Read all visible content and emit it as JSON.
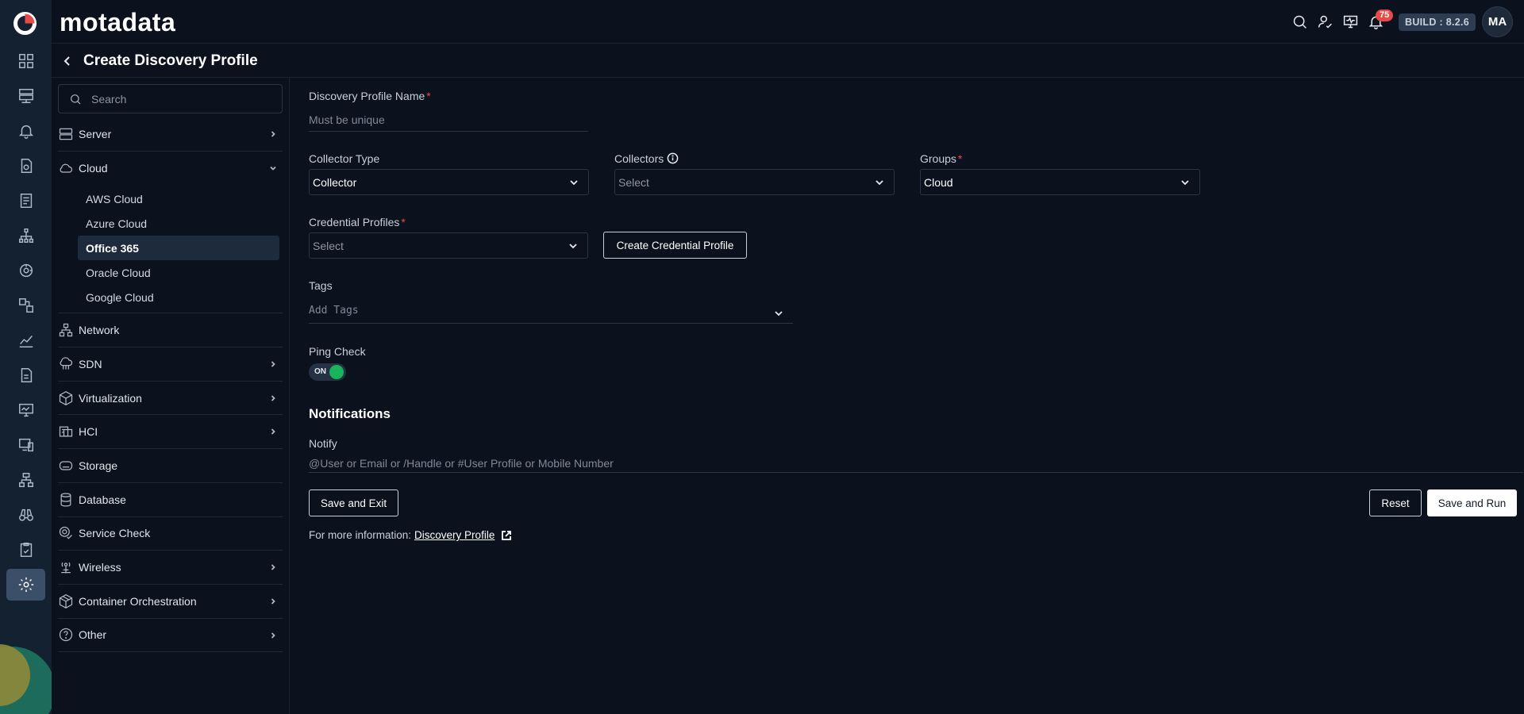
{
  "app": {
    "brand": "motadata"
  },
  "topbar": {
    "notification_count": "75",
    "build": "BUILD : 8.2.6",
    "avatar_initials": "MA"
  },
  "rail": {
    "icons": [
      "logo-icon",
      "dashboard-grid-icon",
      "inventory-icon",
      "alert-bell-icon",
      "log-file-icon",
      "report-document-icon",
      "topology-icon",
      "monitor-radar-icon",
      "apps-flow-icon",
      "metric-chart-icon",
      "document-icon",
      "screen-monitor-icon",
      "device-icon",
      "network-tree-icon",
      "binoculars-icon",
      "audit-clipboard-icon",
      "settings-gear-icon"
    ],
    "active": "settings-gear-icon"
  },
  "page": {
    "title": "Create Discovery Profile"
  },
  "sidebar": {
    "search_placeholder": "Search",
    "categories": [
      {
        "label": "Server",
        "icon": "server-icon",
        "chevron": "right"
      },
      {
        "label": "Cloud",
        "icon": "cloud-icon",
        "chevron": "down",
        "expanded": true,
        "items": [
          "AWS Cloud",
          "Azure Cloud",
          "Office 365",
          "Oracle Cloud",
          "Google Cloud"
        ],
        "selected": "Office 365"
      },
      {
        "label": "Network",
        "icon": "network-icon",
        "chevron": "none"
      },
      {
        "label": "SDN",
        "icon": "sdn-cloud-icon",
        "chevron": "right"
      },
      {
        "label": "Virtualization",
        "icon": "cube-icon",
        "chevron": "right"
      },
      {
        "label": "HCI",
        "icon": "hci-icon",
        "chevron": "right"
      },
      {
        "label": "Storage",
        "icon": "storage-icon",
        "chevron": "none"
      },
      {
        "label": "Database",
        "icon": "database-icon",
        "chevron": "none"
      },
      {
        "label": "Service Check",
        "icon": "service-check-icon",
        "chevron": "none"
      },
      {
        "label": "Wireless",
        "icon": "wireless-icon",
        "chevron": "right"
      },
      {
        "label": "Container Orchestration",
        "icon": "container-icon",
        "chevron": "right"
      },
      {
        "label": "Other",
        "icon": "help-circle-icon",
        "chevron": "right"
      }
    ]
  },
  "form": {
    "profile_name_label": "Discovery Profile Name",
    "profile_name_placeholder": "Must be unique",
    "collector_type_label": "Collector Type",
    "collector_type_value": "Collector",
    "collectors_label": "Collectors",
    "collectors_placeholder": "Select",
    "groups_label": "Groups",
    "groups_value": "Cloud",
    "credential_profiles_label": "Credential Profiles",
    "credential_profiles_placeholder": "Select",
    "create_credential_button": "Create Credential Profile",
    "tags_label": "Tags",
    "tags_placeholder": "Add Tags",
    "ping_check_label": "Ping Check",
    "ping_check_state": "ON",
    "required_marker": "*",
    "notifications_title": "Notifications",
    "notify_label": "Notify",
    "notify_placeholder": "@User or Email or /Handle or #User Profile or Mobile Number",
    "save_exit_button": "Save and Exit",
    "reset_button": "Reset",
    "save_run_button": "Save and Run",
    "more_info_text": "For more information:",
    "more_info_link": "Discovery Profile"
  },
  "colors": {
    "background": "#0b121d",
    "rail": "#142131",
    "accent_red": "#e84a4a",
    "toggle_on": "#18b35a"
  }
}
